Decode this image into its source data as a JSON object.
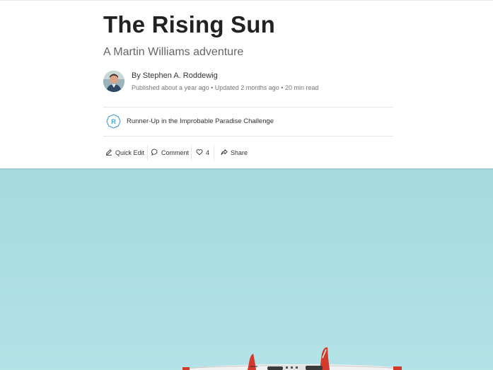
{
  "story": {
    "title": "The Rising Sun",
    "subtitle": "A Martin Williams adventure",
    "author_line": "By Stephen A. Roddewig",
    "meta_line": "Published about a year ago • Updated 2 months ago • 20 min read"
  },
  "award": {
    "badge_letter": "R",
    "text": "Runner-Up in the Improbable Paradise Challenge",
    "badge_color": "#4aa3d8"
  },
  "actions": {
    "quick_edit": "Quick Edit",
    "comment": "Comment",
    "likes": "4",
    "share": "Share"
  },
  "icons": {
    "quick_edit": "pencil-icon",
    "comment": "speech-bubble-icon",
    "likes": "heart-icon",
    "share": "share-arrow-icon"
  },
  "colors": {
    "sky": "#a7dce2",
    "rule": "#e6e6e6",
    "text_muted": "#666666"
  }
}
